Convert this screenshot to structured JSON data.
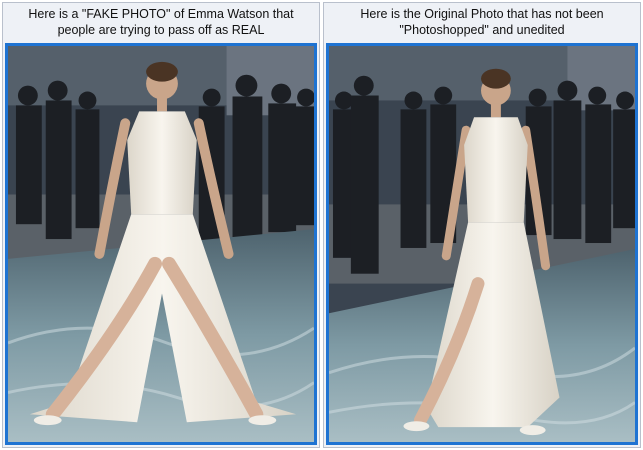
{
  "panels": [
    {
      "caption": "Here is a \"FAKE PHOTO\" of Emma Watson that people are trying to pass off as REAL",
      "photo": "edited photo of woman in long white halter dress with high leg slits standing wide-legged on a sea-print carpet, crowd of photographers behind"
    },
    {
      "caption": "Here is the Original Photo that has not been \"Photoshopped\" and unedited",
      "photo": "original photo of woman in long white halter dress with leg slit standing on a sea-print carpet, crowd behind"
    }
  ],
  "colors": {
    "frame_border": "#1e73d2",
    "panel_background": "#eef1f6",
    "dress": "#f3efe6",
    "carpet": "#6f8c97"
  }
}
